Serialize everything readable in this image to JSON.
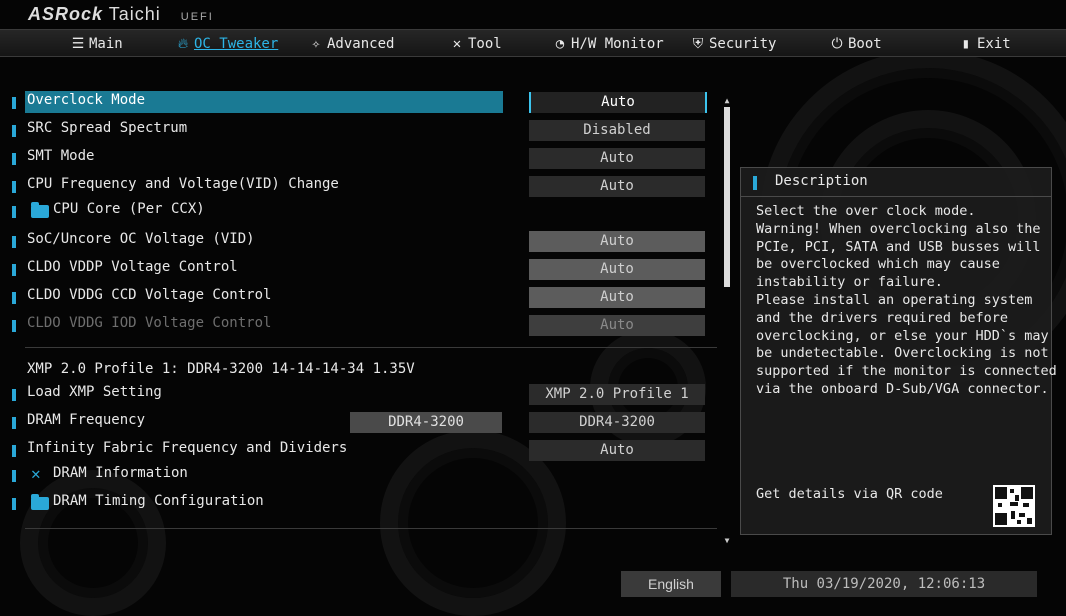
{
  "brand": {
    "part1": "ASRock",
    "part2": "Taichi",
    "part3": "UEFI"
  },
  "tabs": [
    {
      "label": "Main",
      "icon": "list-icon"
    },
    {
      "label": "OC Tweaker",
      "icon": "flame-icon",
      "active": true
    },
    {
      "label": "Advanced",
      "icon": "star-icon"
    },
    {
      "label": "Tool",
      "icon": "tools-icon"
    },
    {
      "label": "H/W Monitor",
      "icon": "monitor-icon"
    },
    {
      "label": "Security",
      "icon": "shield-icon"
    },
    {
      "label": "Boot",
      "icon": "power-icon"
    },
    {
      "label": "Exit",
      "icon": "exit-door-icon"
    }
  ],
  "settings": [
    {
      "label": "Overclock Mode",
      "value": "Auto"
    },
    {
      "label": "SRC Spread Spectrum",
      "value": "Disabled"
    },
    {
      "label": "SMT Mode",
      "value": "Auto"
    },
    {
      "label": "CPU Frequency and Voltage(VID) Change",
      "value": "Auto"
    },
    {
      "label": "CPU Core (Per CCX)"
    },
    {
      "label": "SoC/Uncore OC Voltage (VID)",
      "value": "Auto"
    },
    {
      "label": "CLDO VDDP Voltage Control",
      "value": "Auto"
    },
    {
      "label": "CLDO VDDG CCD Voltage Control",
      "value": "Auto"
    },
    {
      "label": "CLDO VDDG IOD Voltage Control",
      "value": "Auto"
    },
    {
      "label": "XMP 2.0 Profile 1: DDR4-3200 14-14-14-34 1.35V"
    },
    {
      "label": "Load XMP Setting",
      "value": "XMP 2.0 Profile 1"
    },
    {
      "label": "DRAM Frequency",
      "current": "DDR4-3200",
      "value": "DDR4-3200"
    },
    {
      "label": "Infinity Fabric Frequency and Dividers",
      "value": "Auto"
    },
    {
      "label": "DRAM Information"
    },
    {
      "label": "DRAM Timing Configuration"
    }
  ],
  "description": {
    "title": "Description",
    "text": "Select the over clock mode.\nWarning! When overclocking also the\nPCIe, PCI, SATA and USB busses will\nbe overclocked which may cause\ninstability or failure.\nPlease install an operating system\nand the drivers required before\noverclocking, or else your HDD`s may\nbe undetectable. Overclocking is not\nsupported if the monitor is connected\nvia the onboard D-Sub/VGA connector.",
    "qr_label": "Get details via QR code"
  },
  "footer": {
    "language": "English",
    "datetime": "Thu 03/19/2020, 12:06:13"
  },
  "colors": {
    "accent": "#2aa8d8",
    "selected_row": "#1a7a94"
  }
}
